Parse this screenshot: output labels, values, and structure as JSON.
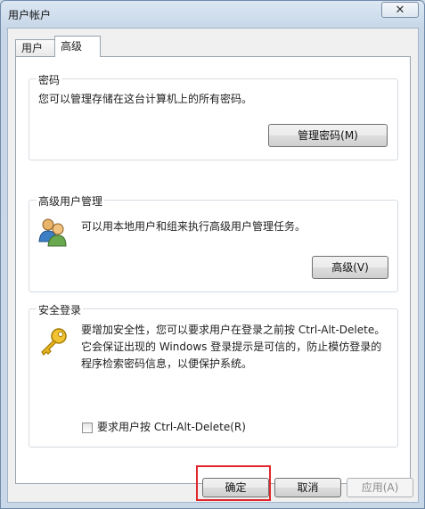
{
  "window": {
    "title": "用户帐户",
    "close_glyph": "✕"
  },
  "tabs": [
    {
      "label": "用户",
      "active": false
    },
    {
      "label": "高级",
      "active": true
    }
  ],
  "passwords": {
    "title": "密码",
    "description": "您可以管理存储在这台计算机上的所有密码。",
    "button": "管理密码(M)"
  },
  "advanced_users": {
    "title": "高级用户管理",
    "description": "可以用本地用户和组来执行高级用户管理任务。",
    "button": "高级(V)",
    "icon": "users-icon"
  },
  "secure_logon": {
    "title": "安全登录",
    "line1": "要增加安全性，您可以要求用户在登录之前按 Ctrl-Alt-Delete。",
    "line2": "它会保证出现的 Windows 登录提示是可信的，防止模仿登录的",
    "line3": "程序检索密码信息，以便保护系统。",
    "checkbox_label": "要求用户按 Ctrl-Alt-Delete(R)",
    "checkbox_checked": false,
    "icon": "key-icon"
  },
  "buttons": {
    "ok": "确定",
    "cancel": "取消",
    "apply": "应用(A)"
  },
  "colors": {
    "highlight": "#e0262a",
    "accent": "#6f8aa8"
  }
}
